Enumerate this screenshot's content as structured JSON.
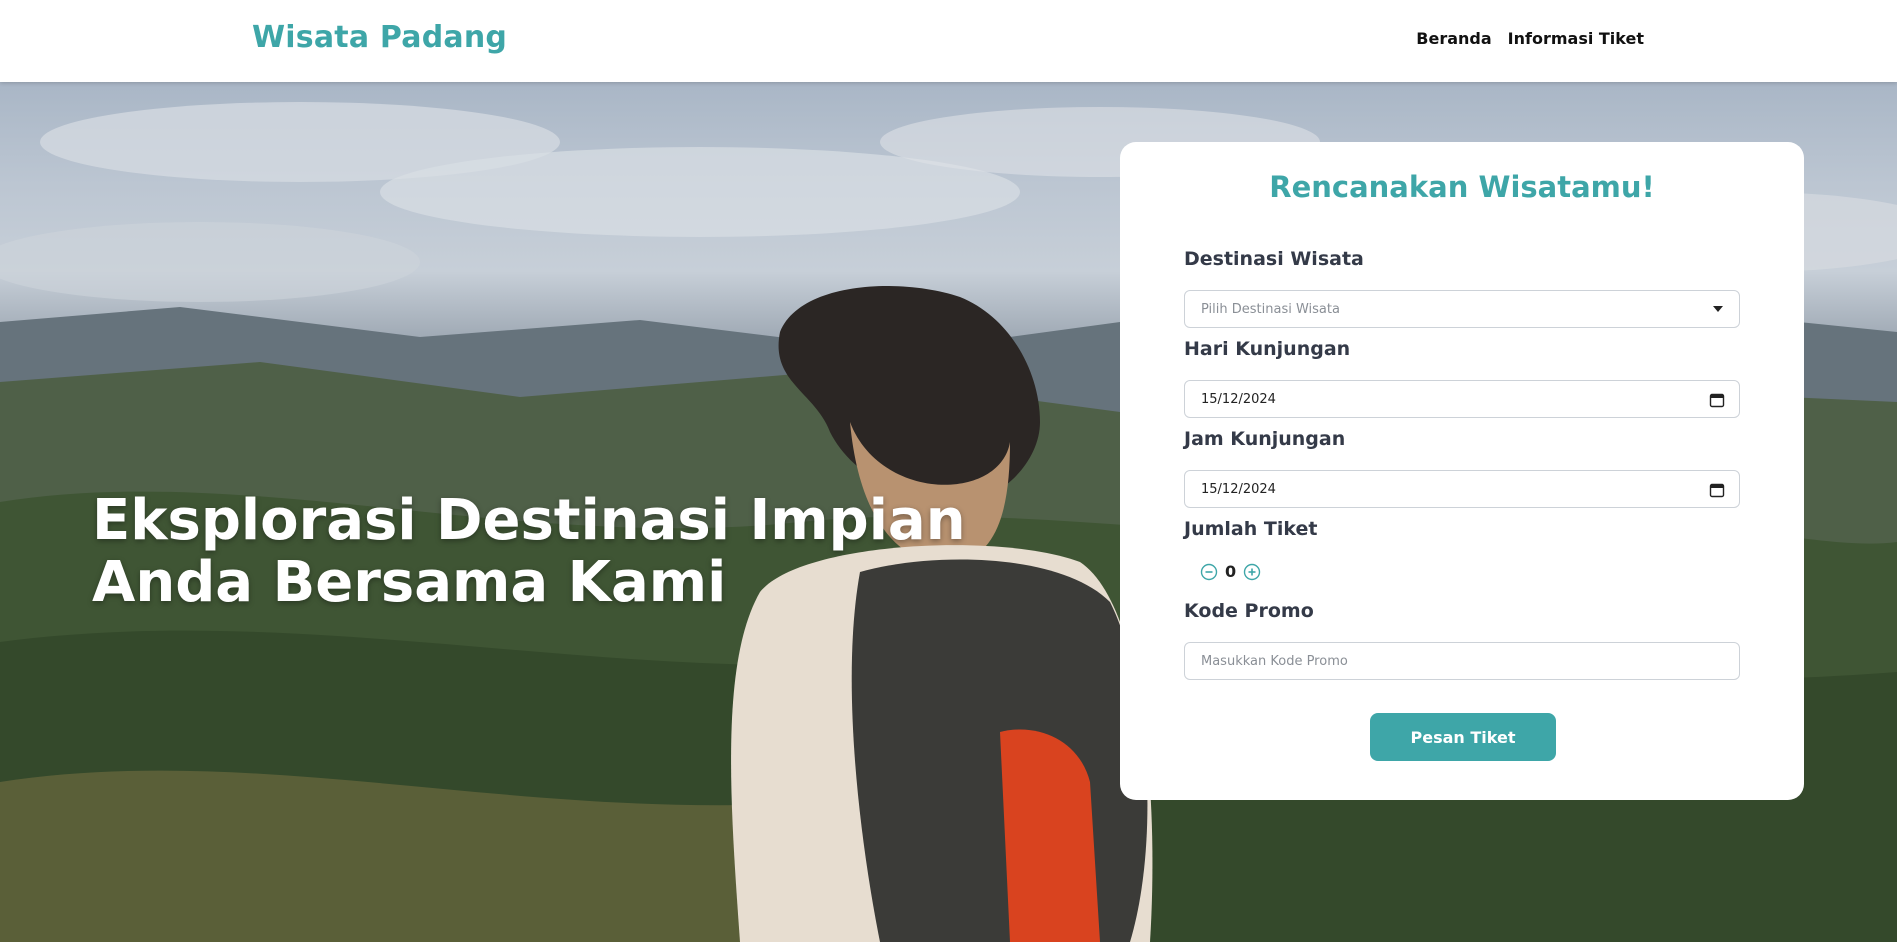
{
  "header": {
    "brand": "Wisata Padang",
    "nav": [
      "Beranda",
      "Informasi Tiket"
    ]
  },
  "hero": {
    "title_line1": "Eksplorasi Destinasi Impian",
    "title_line2": "Anda Bersama Kami"
  },
  "form": {
    "title": "Rencanakan Wisatamu!",
    "destination": {
      "label": "Destinasi Wisata",
      "placeholder": "Pilih Destinasi Wisata",
      "icon": "caret-down-icon"
    },
    "visit_day": {
      "label": "Hari Kunjungan",
      "value": "15/12/2024",
      "icon": "calendar-icon"
    },
    "visit_time": {
      "label": "Jam Kunjungan",
      "value": "15/12/2024",
      "icon": "calendar-icon"
    },
    "tickets": {
      "label": "Jumlah Tiket",
      "value": "0",
      "minus_icon": "minus-circle-icon",
      "plus_icon": "plus-circle-icon"
    },
    "promo": {
      "label": "Kode Promo",
      "placeholder": "Masukkan Kode Promo"
    },
    "submit_label": "Pesan Tiket"
  },
  "colors": {
    "accent": "#3ea6a8",
    "label": "#343a48"
  }
}
